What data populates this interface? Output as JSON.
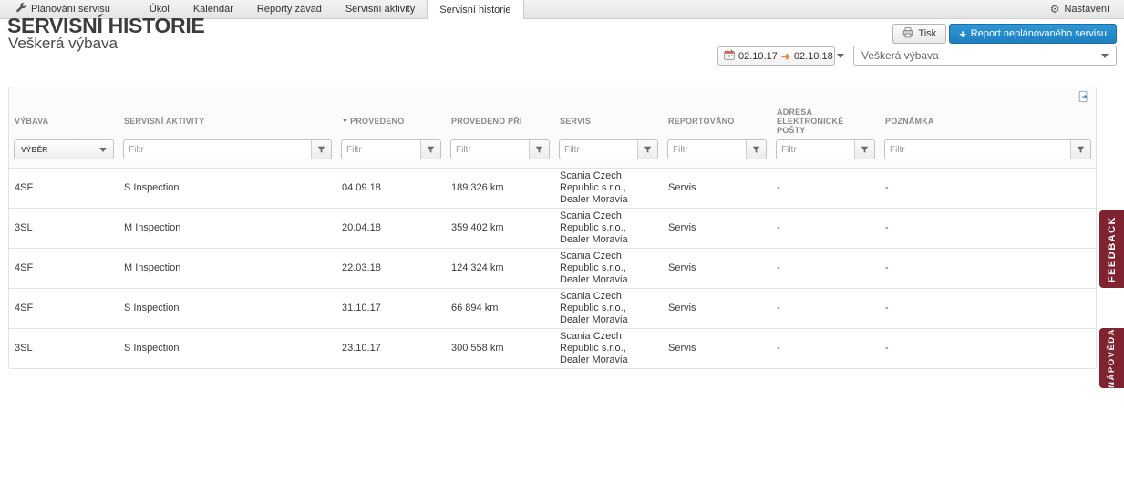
{
  "topbar": {
    "planning_label": "Plánování servisu",
    "tabs": [
      {
        "label": "Úkol"
      },
      {
        "label": "Kalendář"
      },
      {
        "label": "Reporty závad"
      },
      {
        "label": "Servisní aktivity"
      },
      {
        "label": "Servisní historie"
      }
    ],
    "settings_label": "Nastavení"
  },
  "header": {
    "title": "SERVISNÍ HISTORIE",
    "subtitle": "Veškerá výbava",
    "print_label": "Tisk",
    "report_label": "Report neplánovaného servisu",
    "date_from": "02.10.17",
    "date_to": "02.10.18",
    "equipment_filter_value": "Veškerá výbava"
  },
  "icons": {
    "sort_desc": "▼",
    "date_arrow": "➜",
    "plus": "+",
    "gear": "⚙"
  },
  "table": {
    "columns": [
      "Výbava",
      "Servisní aktivity",
      "Provedeno",
      "Provedeno při",
      "Servis",
      "Reportováno",
      "Adresa elektronické pošty",
      "Poznámka"
    ],
    "select_label": "Výběr",
    "filter_placeholder": "Filtr",
    "rows": [
      {
        "vybava": "4SF",
        "aktivita": "S Inspection",
        "provedeno": "04.09.18",
        "provedeno_pri": "189 326 km",
        "servis": "Scania Czech Republic s.r.o., Dealer Moravia",
        "reportovano": "Servis",
        "adresa": "-",
        "poznamka": "-"
      },
      {
        "vybava": "3SL",
        "aktivita": "M Inspection",
        "provedeno": "20.04.18",
        "provedeno_pri": "359 402 km",
        "servis": "Scania Czech Republic s.r.o., Dealer Moravia",
        "reportovano": "Servis",
        "adresa": "-",
        "poznamka": "-"
      },
      {
        "vybava": "4SF",
        "aktivita": "M Inspection",
        "provedeno": "22.03.18",
        "provedeno_pri": "124 324 km",
        "servis": "Scania Czech Republic s.r.o., Dealer Moravia",
        "reportovano": "Servis",
        "adresa": "-",
        "poznamka": "-"
      },
      {
        "vybava": "4SF",
        "aktivita": "S Inspection",
        "provedeno": "31.10.17",
        "provedeno_pri": "66 894 km",
        "servis": "Scania Czech Republic s.r.o., Dealer Moravia",
        "reportovano": "Servis",
        "adresa": "-",
        "poznamka": "-"
      },
      {
        "vybava": "3SL",
        "aktivita": "S Inspection",
        "provedeno": "23.10.17",
        "provedeno_pri": "300 558 km",
        "servis": "Scania Czech Republic s.r.o., Dealer Moravia",
        "reportovano": "Servis",
        "adresa": "-",
        "poznamka": "-"
      }
    ]
  },
  "side_tabs": {
    "feedback": "FEEDBACK",
    "help": "NÁPOVĚDA"
  }
}
